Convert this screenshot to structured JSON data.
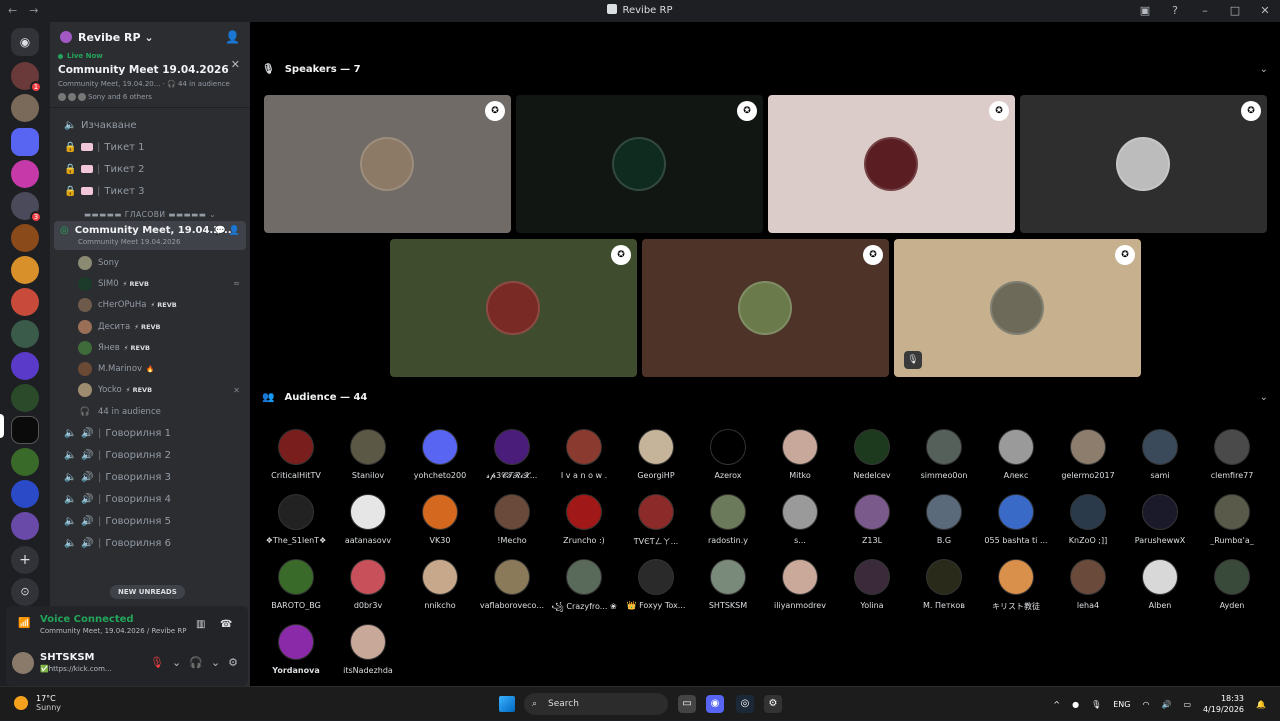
{
  "titlebar": {
    "title": "Revibe RP",
    "back": "←",
    "forward": "→"
  },
  "guild": {
    "name": "Revibe RP ⌄"
  },
  "live_event": {
    "status": "Live Now",
    "title": "Community Meet 19.04.2026",
    "sub": "Community Meet, 19.04.20...  · 🎧 44 in audience",
    "avatars_text": "Sony and 6 others"
  },
  "text_channels": [
    {
      "name": "Изчакване",
      "icon": "speaker-lock-icon"
    },
    {
      "name": "Тикет 1",
      "icon": "lock-icon"
    },
    {
      "name": "Тикет 2",
      "icon": "lock-icon"
    },
    {
      "name": "Тикет 3",
      "icon": "lock-icon"
    }
  ],
  "category": "▬▬▬▬▬ ГЛАСОВИ ▬▬▬▬▬ ⌄",
  "active_voice": {
    "name": "Community Meet, 19.04.2...",
    "sub": "Community Meet 19.04.2026"
  },
  "members": [
    {
      "name": "Sony",
      "tag": "",
      "color": "#8b8b73"
    },
    {
      "name": "SIM0",
      "tag": "⚡ REVB",
      "color": "#1d3b2b"
    },
    {
      "name": "cHerOPuHa",
      "tag": "⚡ REVB",
      "color": "#6d5a4a"
    },
    {
      "name": "Десита",
      "tag": "⚡ REVB",
      "color": "#9a6f58"
    },
    {
      "name": "Янев",
      "tag": "⚡ REVB",
      "color": "#3f6b3a"
    },
    {
      "name": "M.Marinov",
      "tag": "🔥",
      "color": "#6a4a35"
    },
    {
      "name": "Yocko",
      "tag": "⚡ REVB",
      "color": "#9d8c70"
    }
  ],
  "audience_count": "44 in audience",
  "voice_channels": [
    "Говорилня 1",
    "Говорилня 2",
    "Говорилня 3",
    "Говорилня 4",
    "Говорилня 5",
    "Говорилня 6"
  ],
  "new_unreads": "NEW UNREADS",
  "voice_panel": {
    "status": "Voice Connected",
    "channel": "Community Meet, 19.04.2026 / Revibe RP",
    "username": "SHTSKSM",
    "user_status": "✅https://kick.com..."
  },
  "speakers": {
    "title": "Speakers — 7"
  },
  "speaker_tiles": [
    {
      "color": "#706b66",
      "avatar": "#8c7a66",
      "badge": "✪",
      "muted": ""
    },
    {
      "color": "#111612",
      "avatar": "#0f2a1e",
      "badge": "✪",
      "muted": ""
    },
    {
      "color": "#dcccc9",
      "avatar": "#5a1e22",
      "badge": "✪",
      "muted": ""
    },
    {
      "color": "#2e2e2e",
      "avatar": "#bcbcbc",
      "badge": "✪",
      "muted": ""
    },
    {
      "color": "#3f4d2e",
      "avatar": "#7a2a24",
      "badge": "✪",
      "muted": ""
    },
    {
      "color": "#4e3428",
      "avatar": "#6a7a4a",
      "badge": "✪",
      "muted": ""
    },
    {
      "color": "#c6b08e",
      "avatar": "#6d6a5a",
      "badge": "✪",
      "muted": "🎙"
    }
  ],
  "audience": {
    "title": "Audience — 44"
  },
  "audience_members": [
    {
      "name": "CriticalHitTV",
      "color": "#7a1d1d"
    },
    {
      "name": "Stanilov",
      "color": "#5b5845"
    },
    {
      "name": "yohcheto200",
      "color": "#5865f2"
    },
    {
      "name": "𝓼𝓹3𝓒𝓣𝓡𝓲𝓧...",
      "color": "#4b1d7a"
    },
    {
      "name": "I v a n o w .",
      "color": "#8a3a2e"
    },
    {
      "name": "GeorgiHP",
      "color": "#c6b49a"
    },
    {
      "name": "Azerox",
      "color": "#000000"
    },
    {
      "name": "Mitko",
      "color": "#c8a89a"
    },
    {
      "name": "Nedelcev",
      "color": "#1e3a1e"
    },
    {
      "name": "simmeo0on",
      "color": "#55605a"
    },
    {
      "name": "Алекс",
      "color": "#9a9a9a"
    },
    {
      "name": "gelermo2017",
      "color": "#8d7d6d"
    },
    {
      "name": "sami",
      "color": "#3a4a5a"
    },
    {
      "name": "clemfire77",
      "color": "#4a4a4a"
    },
    {
      "name": "❖The_S1lenT❖",
      "color": "#222222"
    },
    {
      "name": "aatanasovv",
      "color": "#e6e6e6"
    },
    {
      "name": "VK30",
      "color": "#d3681e"
    },
    {
      "name": "!Mecho",
      "color": "#6a4a3a"
    },
    {
      "name": "Zruncho :)",
      "color": "#a01818"
    },
    {
      "name": "ƬVЄƬㄥㄚ...",
      "color": "#8c2a2a"
    },
    {
      "name": "radostin.y",
      "color": "#6a7a5a"
    },
    {
      "name": "s...",
      "color": "#9a9a9a"
    },
    {
      "name": "Z13L",
      "color": "#7a5a8a"
    },
    {
      "name": "B.G",
      "color": "#5a6a7a"
    },
    {
      "name": "055 bashta ti ...",
      "color": "#3a6ac8"
    },
    {
      "name": "KnZoO ;]]",
      "color": "#2a3a4a"
    },
    {
      "name": "ParushewwX",
      "color": "#1a1a2a"
    },
    {
      "name": "_Rumbα'a_",
      "color": "#5a5a4a"
    },
    {
      "name": "BAROTO_BG",
      "color": "#3a6a2a"
    },
    {
      "name": "d0br3v",
      "color": "#c8505a"
    },
    {
      "name": "nnikcho",
      "color": "#c8a88a"
    },
    {
      "name": "vaflaborovecо...",
      "color": "#8a7a5a"
    },
    {
      "name": "꧁ Crazyfro... ❀",
      "color": "#5a6a5a"
    },
    {
      "name": "👑 Foxyy Tox...",
      "color": "#2a2a2a"
    },
    {
      "name": "SHTSKSM",
      "color": "#7a8a7a"
    },
    {
      "name": "iliyanmodrev",
      "color": "#caa89a"
    },
    {
      "name": "Yolina",
      "color": "#3a2a3a"
    },
    {
      "name": "M. Петков",
      "color": "#2a2a1a"
    },
    {
      "name": "キリスト教徒",
      "color": "#d8904a"
    },
    {
      "name": "leha4",
      "color": "#6a4a3a"
    },
    {
      "name": "Alben",
      "color": "#d8d8d8"
    },
    {
      "name": "Ayden",
      "color": "#3a4a3a"
    },
    {
      "name": "Yordanova",
      "color": "#8a2aa8"
    },
    {
      "name": "itsNadezhda",
      "color": "#c8a898"
    }
  ],
  "taskbar": {
    "temp": "17°C",
    "weather": "Sunny",
    "search": "Search",
    "lang": "ENG",
    "time": "18:33",
    "date": "4/19/2026"
  }
}
